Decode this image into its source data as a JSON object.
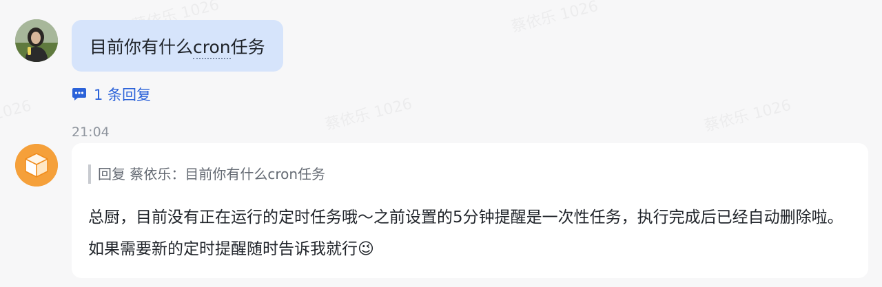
{
  "user_message": {
    "text_before": "目前你有什么",
    "text_underlined": "cron",
    "text_after": "任务"
  },
  "reply_count": {
    "icon": "comment-icon",
    "label": "1 条回复"
  },
  "timestamp": "21:04",
  "bot_message": {
    "quote": "回复 蔡依乐：目前你有什么cron任务",
    "text": "总厨，目前没有正在运行的定时任务哦～之前设置的5分钟提醒是一次性任务，执行完成后已经自动删除啦。如果需要新的定时提醒随时告诉我就行😉"
  },
  "colors": {
    "user_bubble": "#d6e4fb",
    "link_blue": "#2b62d9",
    "bot_avatar": "#f5a03a",
    "background": "#f7f7f8"
  }
}
